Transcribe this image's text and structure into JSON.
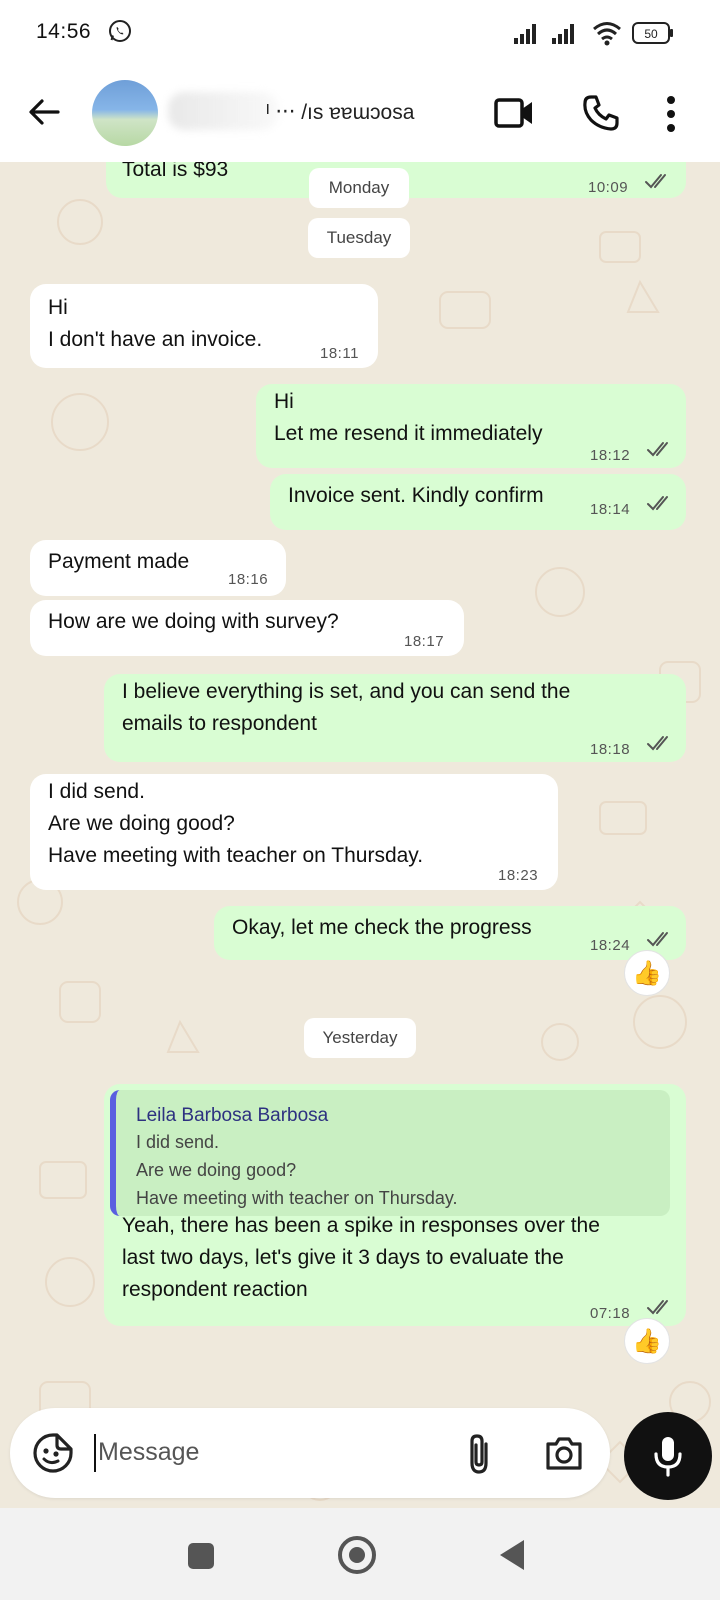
{
  "status_bar": {
    "time": "14:56",
    "battery": "50"
  },
  "header": {
    "contact_name": "ᴵ ‧‧‧ /ıs ɐɐɯɔosa"
  },
  "dates": {
    "monday": "Monday",
    "tuesday": "Tuesday",
    "yesterday": "Yesterday"
  },
  "messages": [
    {
      "dir": "out",
      "text": "Total is $93",
      "time": "10:09"
    },
    {
      "dir": "in",
      "text": "Hi\nI don't have an invoice.",
      "time": "18:11"
    },
    {
      "dir": "out",
      "text": "Hi\nLet me resend it immediately",
      "time": "18:12"
    },
    {
      "dir": "out",
      "text": "Invoice sent. Kindly confirm",
      "time": "18:14"
    },
    {
      "dir": "in",
      "text": "Payment made",
      "time": "18:16"
    },
    {
      "dir": "in",
      "text": "How are we doing with survey?",
      "time": "18:17"
    },
    {
      "dir": "out",
      "text": "I believe everything is set, and you can send the\nemails to respondent",
      "time": "18:18"
    },
    {
      "dir": "in",
      "text": "I did send.\nAre we doing good?\nHave meeting with teacher on Thursday.",
      "time": "18:23"
    },
    {
      "dir": "out",
      "text": "Okay, let me check the progress",
      "time": "18:24",
      "reaction": "👍"
    },
    {
      "dir": "out",
      "text": "Yeah, there has been a spike in responses over the\nlast two days, let's give it 3 days to evaluate the\nrespondent reaction",
      "time": "07:18",
      "reaction": "👍",
      "quote": {
        "author": "Leila Barbosa Barbosa",
        "text": "I did send.\nAre we doing good?\nHave meeting with teacher on Thursday."
      }
    }
  ],
  "composer": {
    "placeholder": "Message"
  },
  "colors": {
    "outgoing": "#d9fdd3",
    "incoming": "#ffffff",
    "wallpaper": "#efe9dc",
    "ticks": "#555555",
    "quote_bar": "#5a5fe0"
  },
  "icons": {
    "back": "arrow-left-icon",
    "video": "video-camera-icon",
    "call": "phone-icon",
    "more": "more-vertical-icon",
    "sticker": "sticker-icon",
    "attach": "paperclip-icon",
    "camera": "camera-icon",
    "mic": "microphone-icon"
  }
}
